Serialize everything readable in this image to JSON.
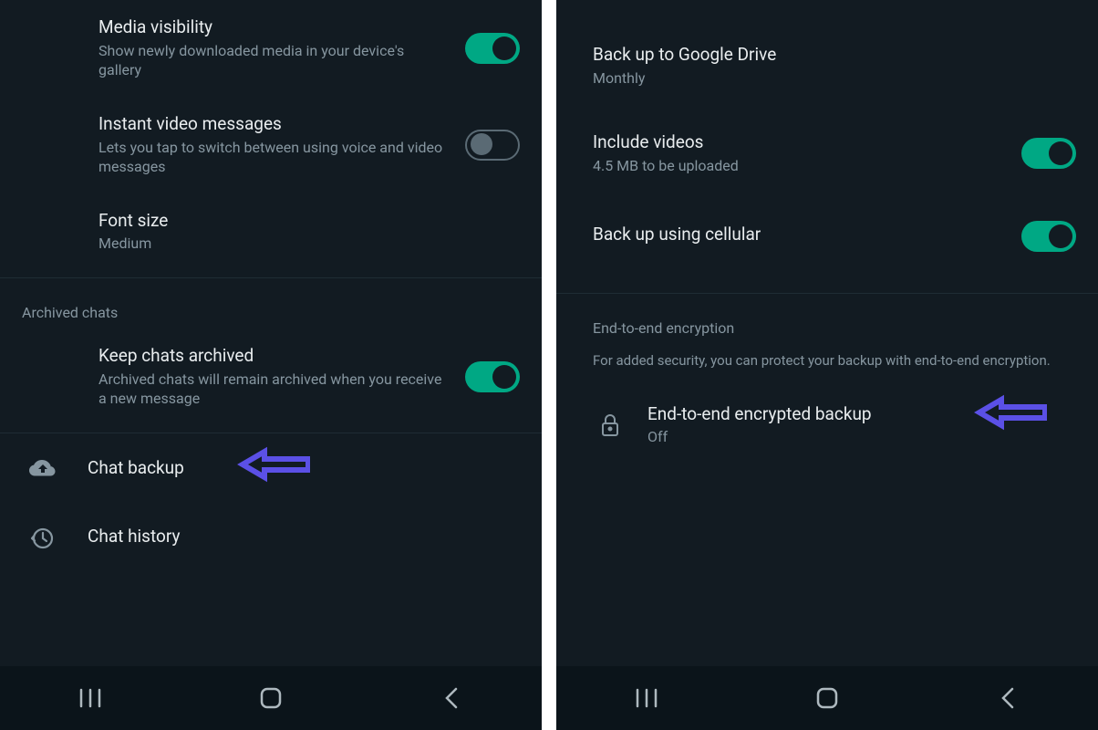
{
  "left": {
    "media_visibility": {
      "title": "Media visibility",
      "subtitle": "Show newly downloaded media in your device's gallery",
      "on": true
    },
    "instant_video": {
      "title": "Instant video messages",
      "subtitle": "Lets you tap to switch between using voice and video messages",
      "on": false
    },
    "font_size": {
      "title": "Font size",
      "subtitle": "Medium"
    },
    "archived_header": "Archived chats",
    "keep_archived": {
      "title": "Keep chats archived",
      "subtitle": "Archived chats will remain archived when you receive a new message",
      "on": true
    },
    "chat_backup": {
      "title": "Chat backup"
    },
    "chat_history": {
      "title": "Chat history"
    }
  },
  "right": {
    "google_drive": {
      "title": "Back up to Google Drive",
      "subtitle": "Monthly"
    },
    "include_videos": {
      "title": "Include videos",
      "subtitle": "4.5 MB to be uploaded",
      "on": true
    },
    "cellular": {
      "title": "Back up using cellular",
      "on": true
    },
    "e2e_header": "End-to-end encryption",
    "e2e_desc": "For added security, you can protect your backup with end-to-end encryption.",
    "e2e_backup": {
      "title": "End-to-end encrypted backup",
      "subtitle": "Off"
    }
  }
}
